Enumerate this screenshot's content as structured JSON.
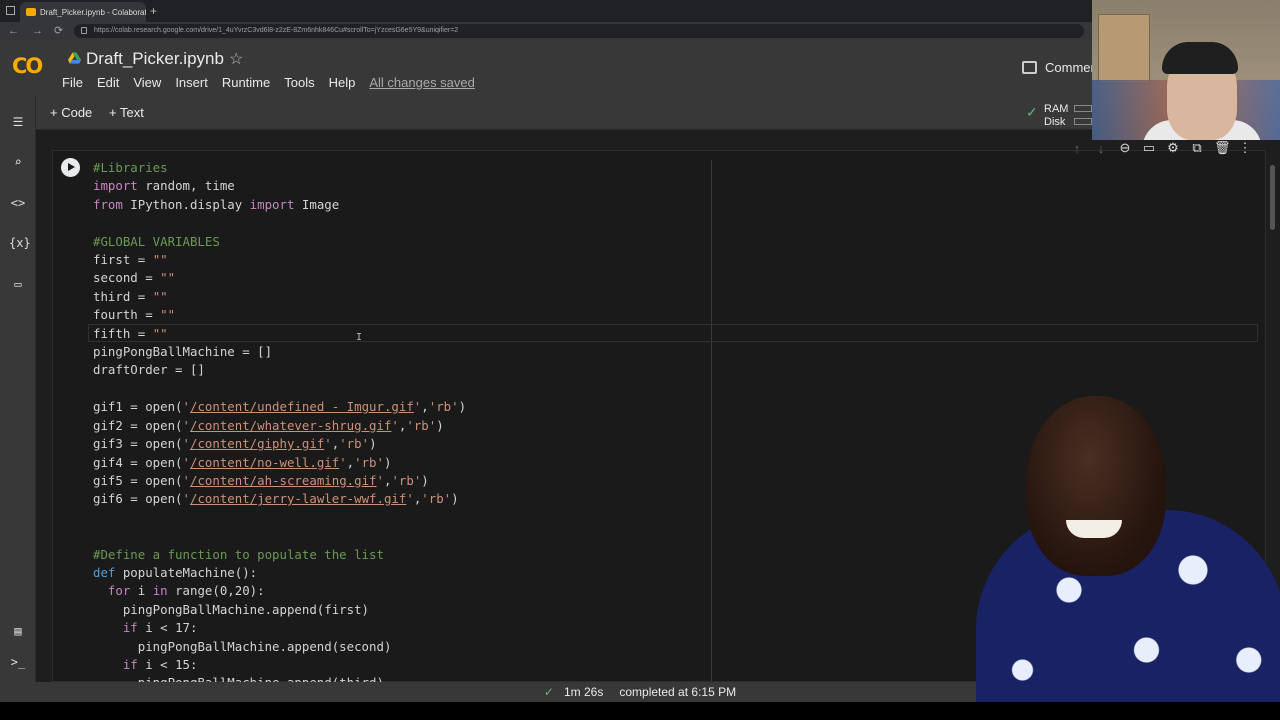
{
  "browser": {
    "tab_title": "Draft_Picker.ipynb - Colaborator",
    "tab_close": "×",
    "new_tab": "+",
    "url": "https://colab.research.google.com/drive/1_4uYvrzC3vd6l8-z2zE-8Zm6nhk846Cu#scrollTo=jYzcesG6e5Y9&uniqifier=2",
    "nav": {
      "back": "←",
      "forward": "→",
      "reload": "⟳"
    }
  },
  "header": {
    "logo": "CO",
    "notebook_title": "Draft_Picker.ipynb",
    "star": "☆",
    "menu": [
      "File",
      "Edit",
      "View",
      "Insert",
      "Runtime",
      "Tools",
      "Help"
    ],
    "save_status": "All changes saved",
    "comment_label": "Commen"
  },
  "toolbar": {
    "add_code": "+ Code",
    "add_text": "+ Text",
    "ram_label": "RAM",
    "disk_label": "Disk",
    "check": "✓"
  },
  "sidebar": {
    "icons": [
      "menu-icon",
      "search-icon",
      "code-icon",
      "variables-icon",
      "folder-icon",
      "terminal-list-icon",
      "terminal-icon"
    ],
    "glyphs": [
      "☰",
      "⌕",
      "<>",
      "{x}",
      "▭",
      "▤",
      ">_"
    ]
  },
  "cell_toolbar": {
    "glyphs": [
      "↑",
      "↓",
      "⊖",
      "▭",
      "⚙",
      "⧉",
      "🗑",
      "⋮"
    ]
  },
  "status": {
    "check": "✓",
    "duration": "1m 26s",
    "message": "completed at 6:15 PM"
  },
  "code": {
    "comment_libraries": "#Libraries",
    "line_import_rest": " random, time",
    "line_from_mod": " IPython.display ",
    "line_from_rest": " Image",
    "kw_import": "import",
    "kw_from": "from",
    "comment_globals": "#GLOBAL VARIABLES",
    "first": "first = ",
    "second": "second = ",
    "third": "third = ",
    "fourth": "fourth = ",
    "fifth": "fifth = ",
    "empty_str": "\"\"",
    "machine": "pingPongBallMachine = []",
    "draft": "draftOrder = []",
    "gifs": [
      {
        "lhs": "gif1 = open(",
        "path": "/content/undefined - Imgur.gif",
        "mode": "'rb'"
      },
      {
        "lhs": "gif2 = open(",
        "path": "/content/whatever-shrug.gif",
        "mode": "'rb'"
      },
      {
        "lhs": "gif3 = open(",
        "path": "/content/giphy.gif",
        "mode": "'rb'"
      },
      {
        "lhs": "gif4 = open(",
        "path": "/content/no-well.gif",
        "mode": "'rb'"
      },
      {
        "lhs": "gif5 = open(",
        "path": "/content/ah-screaming.gif",
        "mode": "'rb'"
      },
      {
        "lhs": "gif6 = open(",
        "path": "/content/jerry-lawler-wwf.gif",
        "mode": "'rb'"
      }
    ],
    "comment_define": "#Define a function to populate the list",
    "kw_def": "def",
    "def_rest": " populateMachine():",
    "kw_for": "for",
    "kw_in": "in",
    "for_var": " i ",
    "for_rest": " range(0,20):",
    "append_first": "pingPongBallMachine.append(first)",
    "kw_if": "if",
    "if1_rest": " i < 17:",
    "append_second": "pingPongBallMachine.append(second)",
    "if2_rest": " i < 15:",
    "append_third": "pingPongBallMachine.append(third)"
  }
}
